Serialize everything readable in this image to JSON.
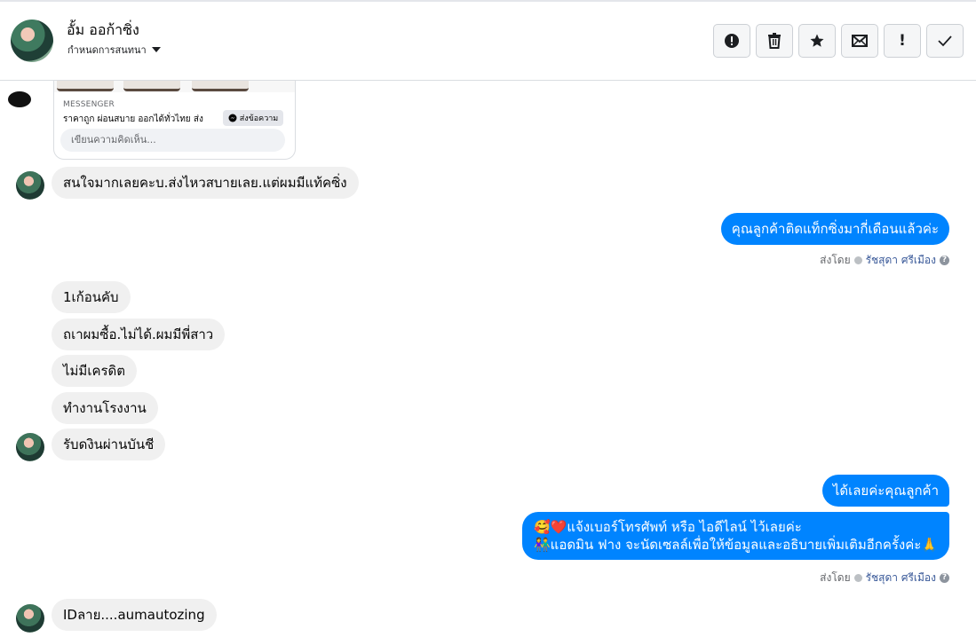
{
  "header": {
    "contact_name": "อั้ม ออก้าซิ่ง",
    "assign_label": "กำหนดการสนทนา",
    "toolbar_icons": [
      "alert-circle-icon",
      "trash-icon",
      "star-icon",
      "mail-icon",
      "exclamation-icon",
      "check-icon"
    ],
    "exclamation_glyph": "!"
  },
  "card": {
    "label": "MESSENGER",
    "text": "ราคาถูก ผ่อนสบาย ออกได้ทั่วไทย ส่ง",
    "button": "ส่งข้อความ",
    "input_placeholder": "เขียนความคิดเห็น..."
  },
  "messages": {
    "m1": "สนใจมากเลยคะบ.ส่งไหวสบายเลย.แต่ผมมีแท้คซิ่ง",
    "m2": "คุณลูกค้าติดแท็กซิ่งมากี่เดือนแล้วค่ะ",
    "m3": "1เก้อนคับ",
    "m4": "ถเาผมซื้อ.ไม่ได้.ผมมีพี่สาว",
    "m5": "ไม่มีเครดิต",
    "m6": "ทำงานโรงงาน",
    "m7": "รับดงินผ่านบันชี",
    "m8": "ได้เลยค่ะคุณลูกค้า",
    "m9_line1": "🥰❤️แจ้งเบอร์โทรศัพท์ หรือ ไอดีไลน์  ไว้เลยค่ะ",
    "m9_line2": "👫แอดมิน ฟาง จะนัดเซลล์เพื่อให้ข้อมูลและอธิบายเพิ่มเติมอีกครั้งค่ะ🙏",
    "m10": "IDลาย....aumautozing"
  },
  "sent_by": {
    "prefix": "ส่งโดย",
    "name": "รัชสุดา ศรีเมือง",
    "help": "?"
  },
  "colors": {
    "outgoing": "#0084ff",
    "incoming": "#f0f0f0"
  }
}
